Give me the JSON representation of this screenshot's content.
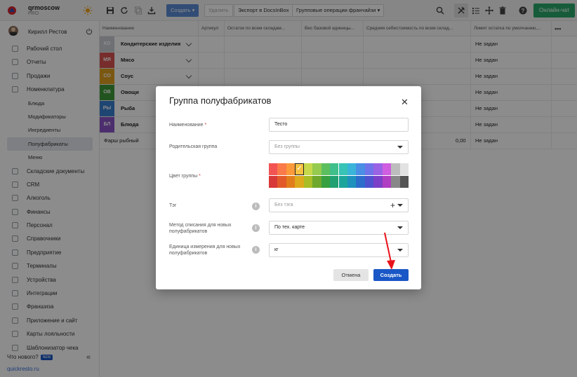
{
  "brand": {
    "name": "qrmoscow",
    "plan": "PRO"
  },
  "user": {
    "name": "Кирилл Рестов"
  },
  "sidebar": {
    "items": [
      {
        "label": "Рабочий стол",
        "icon": "desktop-icon"
      },
      {
        "label": "Отчеты",
        "icon": "reports-icon"
      },
      {
        "label": "Продажи",
        "icon": "sales-icon"
      },
      {
        "label": "Номенклатура",
        "icon": "tag-icon"
      },
      {
        "label": "Блюда",
        "sub": true
      },
      {
        "label": "Модификаторы",
        "sub": true
      },
      {
        "label": "Ингредиенты",
        "sub": true
      },
      {
        "label": "Полуфабрикаты",
        "sub": true,
        "active": true
      },
      {
        "label": "Меню",
        "sub": true
      },
      {
        "label": "Складские документы",
        "icon": "warehouse-icon"
      },
      {
        "label": "CRM",
        "icon": "crm-icon"
      },
      {
        "label": "Алкоголь",
        "icon": "glass-icon"
      },
      {
        "label": "Финансы",
        "icon": "finance-icon"
      },
      {
        "label": "Персонал",
        "icon": "staff-icon"
      },
      {
        "label": "Справочники",
        "icon": "book-icon"
      },
      {
        "label": "Предприятие",
        "icon": "building-icon"
      },
      {
        "label": "Терминалы",
        "icon": "terminal-icon"
      },
      {
        "label": "Устройства",
        "icon": "device-icon"
      },
      {
        "label": "Интеграции",
        "icon": "integration-icon"
      },
      {
        "label": "Франшиза",
        "icon": "franchise-icon"
      },
      {
        "label": "Приложение и сайт",
        "icon": "app-icon"
      },
      {
        "label": "Карты лояльности",
        "icon": "card-icon"
      },
      {
        "label": "Шаблонизатор чека",
        "icon": "receipt-icon"
      }
    ],
    "whats_new": "Что нового?",
    "new_badge": "NEW",
    "site": "quickresto.ru"
  },
  "toolbar": {
    "create": "Создать",
    "delete": "Удалить",
    "export": "Экспорт в DocsInBox",
    "franchise_ops": "Групповые операции франчайзи",
    "online_chat": "Онлайн-чат"
  },
  "table": {
    "columns": [
      "Наименование",
      "Артикул",
      "Остаток по всем складам...",
      "Вес базовой единицы...",
      "Средняя себестоимость по всем склад...",
      "Лимит остатка по умолчанию,..."
    ],
    "more": "•••",
    "rows": [
      {
        "badge": "КО",
        "color": "#c8ccd2",
        "name": "Кондитерские изделия",
        "limit": "Не задан"
      },
      {
        "badge": "МЯ",
        "color": "#d9534f",
        "name": "Мясо",
        "limit": "Не задан"
      },
      {
        "badge": "СО",
        "color": "#e0a020",
        "name": "Соус",
        "limit": "Не задан"
      },
      {
        "badge": "ОВ",
        "color": "#3f9a3a",
        "name": "Овощи",
        "limit": "Не задан"
      },
      {
        "badge": "РЫ",
        "color": "#3a80d0",
        "name": "Рыба",
        "limit": "Не задан"
      },
      {
        "badge": "БЛ",
        "color": "#8a55c8",
        "name": "Блюда",
        "limit": "Не задан"
      }
    ],
    "plain_row": {
      "name": "Фарш рыбный",
      "cost": "0,00",
      "limit": "Не задан"
    }
  },
  "modal": {
    "title": "Группа полуфабрикатов",
    "name_label": "Наименование",
    "name_value": "Тесто",
    "parent_label": "Родительская группа",
    "parent_placeholder": "Без группы",
    "color_label": "Цвет группы",
    "tag_label": "Тэг",
    "tag_placeholder": "Без тэга",
    "method_label": "Метод списания для новых полуфабрикатов",
    "method_value": "По тех. карте",
    "unit_label": "Единица измерения для новых полуфабрикатов",
    "unit_value": "кг",
    "cancel": "Отмена",
    "create": "Создать",
    "palette_top": [
      "#f25454",
      "#fa7a4a",
      "#fb9a3a",
      "#f6c242",
      "#c7d94a",
      "#95cb4e",
      "#5cbf5e",
      "#3fbf8b",
      "#37c3b5",
      "#3ab4d9",
      "#4a8ee6",
      "#6f74ea",
      "#9a63e6",
      "#cf5ee0",
      "#bdbdbd",
      "#e2e2e2"
    ],
    "palette_bottom": [
      "#d83838",
      "#e35a2a",
      "#e27d1c",
      "#dcaa1c",
      "#a8bd26",
      "#6ea92d",
      "#37a040",
      "#21a171",
      "#1ca59a",
      "#1e92bd",
      "#2c6dcc",
      "#4e52ce",
      "#7c40c8",
      "#b03ec2",
      "#888888",
      "#555555"
    ],
    "selected_index": 3
  }
}
